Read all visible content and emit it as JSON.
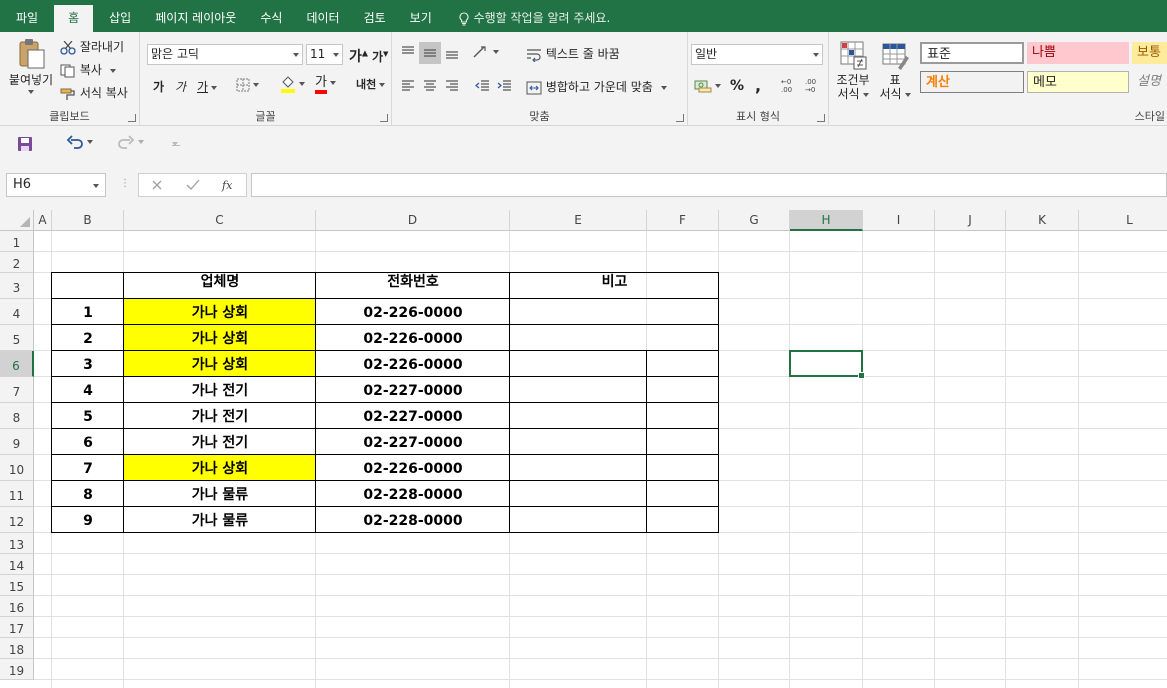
{
  "tabs": [
    "파일",
    "홈",
    "삽입",
    "페이지 레이아웃",
    "수식",
    "데이터",
    "검토",
    "보기"
  ],
  "active_tab": "홈",
  "tell_me": "수행할 작업을 알려 주세요.",
  "ribbon": {
    "clipboard": {
      "paste": "붙여넣기",
      "cut": "잘라내기",
      "copy": "복사",
      "format_painter": "서식 복사",
      "label": "클립보드"
    },
    "font": {
      "name": "맑은 고딕",
      "size": "11",
      "grow": "가",
      "shrink": "가",
      "bold": "가",
      "italic": "가",
      "underline": "가",
      "font_color_glyph": "가",
      "phonetic": "내천",
      "label": "글꼴"
    },
    "alignment": {
      "wrap_text": "텍스트 줄 바꿈",
      "merge_center": "병합하고 가운데 맞춤",
      "label": "맞춤"
    },
    "number": {
      "format": "일반",
      "percent": "%",
      "comma": ",",
      "label": "표시 형식"
    },
    "styles": {
      "conditional": [
        "조건부",
        "서식"
      ],
      "table": [
        "표",
        "서식"
      ],
      "cells": [
        {
          "text": "표준",
          "bg": "#ffffff",
          "color": "#000000"
        },
        {
          "text": "나쁨",
          "bg": "#ffc7ce",
          "color": "#9c0006"
        },
        {
          "text": "보통",
          "bg": "#ffeb9c",
          "color": "#9c5700"
        },
        {
          "text": "계산",
          "bg": "#f2f2f2",
          "color": "#fa7d00"
        },
        {
          "text": "메모",
          "bg": "#ffffcc",
          "color": "#000000"
        },
        {
          "text": "설명",
          "bg": "#ffffff",
          "color": "#7f7f7f"
        }
      ],
      "label": "스타일"
    }
  },
  "name_box": "H6",
  "formula": "",
  "columns": [
    "A",
    "B",
    "C",
    "D",
    "E",
    "F",
    "G",
    "H",
    "I",
    "J",
    "K",
    "L"
  ],
  "rows": [
    "1",
    "2",
    "3",
    "4",
    "5",
    "6",
    "7",
    "8",
    "9",
    "10",
    "11",
    "12",
    "13",
    "14",
    "15",
    "16",
    "17",
    "18",
    "19"
  ],
  "selected_cell": "H6",
  "table": {
    "headers": {
      "company": "업체명",
      "phone": "전화번호",
      "note": "비고"
    },
    "rows": [
      {
        "no": "1",
        "company": "가나 상회",
        "phone": "02-226-0000",
        "highlight": true
      },
      {
        "no": "2",
        "company": "가나 상회",
        "phone": "02-226-0000",
        "highlight": true
      },
      {
        "no": "3",
        "company": "가나 상회",
        "phone": "02-226-0000",
        "highlight": true
      },
      {
        "no": "4",
        "company": "가나 전기",
        "phone": "02-227-0000",
        "highlight": false
      },
      {
        "no": "5",
        "company": "가나 전기",
        "phone": "02-227-0000",
        "highlight": false
      },
      {
        "no": "6",
        "company": "가나 전기",
        "phone": "02-227-0000",
        "highlight": false
      },
      {
        "no": "7",
        "company": "가나 상회",
        "phone": "02-226-0000",
        "highlight": true
      },
      {
        "no": "8",
        "company": "가나 물류",
        "phone": "02-228-0000",
        "highlight": false
      },
      {
        "no": "9",
        "company": "가나 물류",
        "phone": "02-228-0000",
        "highlight": false
      }
    ]
  },
  "colors": {
    "accent": "#217346",
    "highlight": "#ffff00"
  }
}
